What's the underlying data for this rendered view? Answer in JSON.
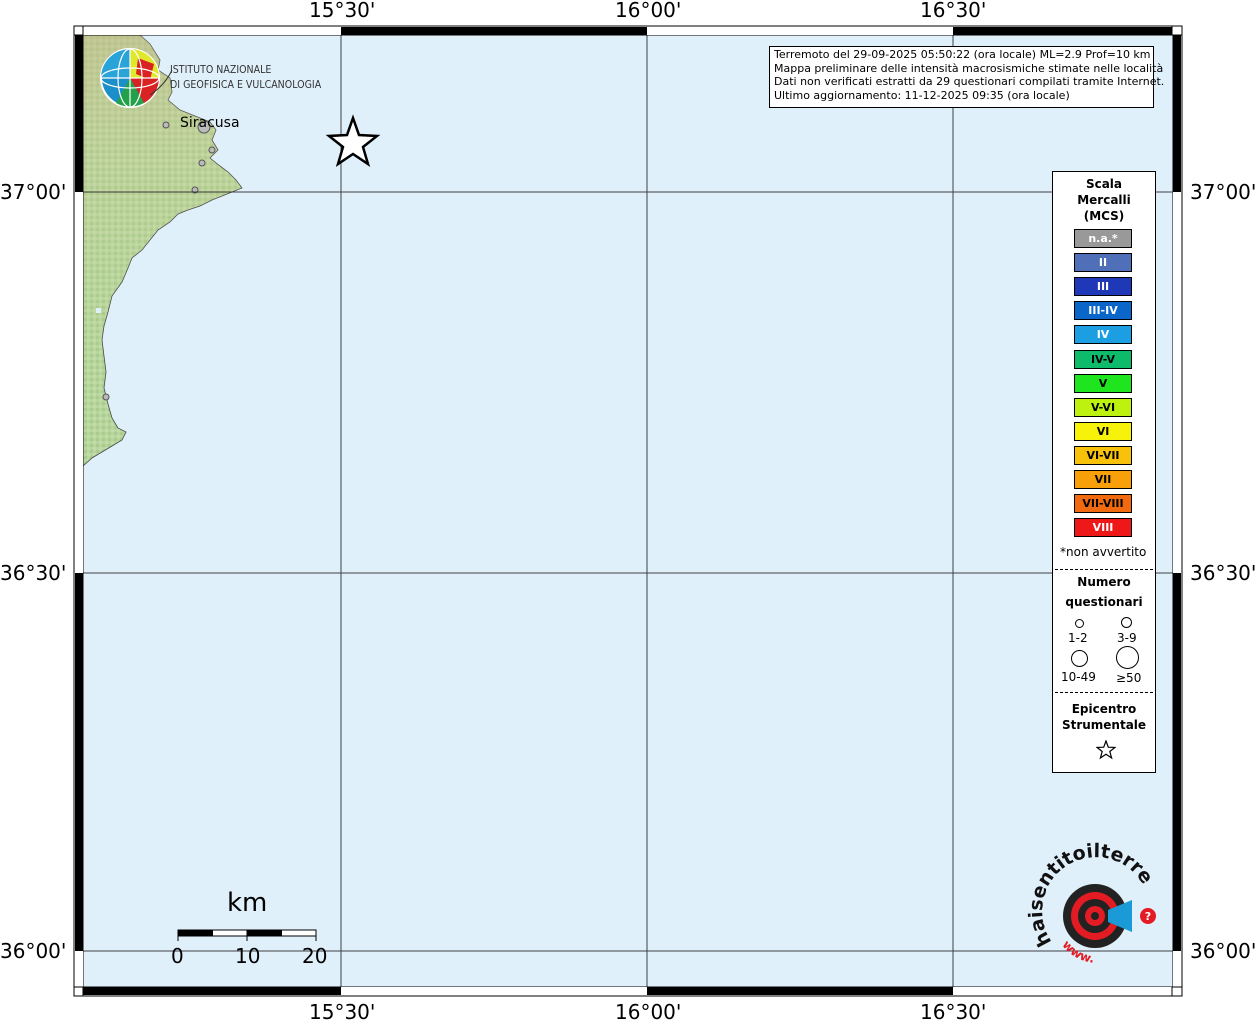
{
  "header": {
    "lines": [
      "Terremoto del 29-09-2025 05:50:22 (ora locale) ML=2.9 Prof=10 km",
      "Mappa preliminare delle intensità macrosismiche stimate nelle località",
      "Dati non verificati estratti da 29 questionari compilati tramite Internet.",
      "Ultimo aggiornamento: 11-12-2025 09:35 (ora locale)"
    ]
  },
  "axes": {
    "top": [
      "15°30'",
      "16°00'",
      "16°30'"
    ],
    "bottom": [
      "15°30'",
      "16°00'",
      "16°30'"
    ],
    "left": [
      "37°00'",
      "36°30'",
      "36°00'"
    ],
    "right": [
      "37°00'",
      "36°30'",
      "36°00'"
    ]
  },
  "map": {
    "place_label": "Siracusa",
    "logo": {
      "line1": "ISTITUTO NAZIONALE",
      "line2": "DI GEOFISICA E VULCANOLOGIA"
    },
    "scale_bar": {
      "unit": "km",
      "ticks": [
        "0",
        "10",
        "20"
      ]
    },
    "brand": {
      "main": "haisentitoilterremoto.it",
      "url": "www."
    },
    "colors": {
      "sea": "#e0f0fb",
      "land": "#b2d39a",
      "star": "#ffffff"
    }
  },
  "legend": {
    "scale_title": [
      "Scala",
      "Mercalli",
      "(MCS)"
    ],
    "intensities": [
      {
        "label": "n.a.*",
        "color": "#999999",
        "text_color": "#ffffff"
      },
      {
        "label": "II",
        "color": "#4f6fb8",
        "text_color": "#ffffff"
      },
      {
        "label": "III",
        "color": "#1f38b8",
        "text_color": "#ffffff"
      },
      {
        "label": "III-IV",
        "color": "#0a66c8",
        "text_color": "#ffffff"
      },
      {
        "label": "IV",
        "color": "#1c9ee2",
        "text_color": "#ffffff"
      },
      {
        "label": "IV-V",
        "color": "#0dbb6a",
        "text_color": "#000000"
      },
      {
        "label": "V",
        "color": "#1fe51f",
        "text_color": "#000000"
      },
      {
        "label": "V-VI",
        "color": "#bdf20e",
        "text_color": "#000000"
      },
      {
        "label": "VI",
        "color": "#f6f20a",
        "text_color": "#000000"
      },
      {
        "label": "VI-VII",
        "color": "#f8c10a",
        "text_color": "#000000"
      },
      {
        "label": "VII",
        "color": "#f8a00a",
        "text_color": "#000000"
      },
      {
        "label": "VII-VIII",
        "color": "#f26a10",
        "text_color": "#000000"
      },
      {
        "label": "VIII",
        "color": "#ee1818",
        "text_color": "#ffffff"
      }
    ],
    "not_felt": "*non avvertito",
    "count_title": [
      "Numero",
      "questionari"
    ],
    "counts": [
      "1-2",
      "3-9",
      "10-49",
      "≥50"
    ],
    "epicenter_title": [
      "Epicentro",
      "Strumentale"
    ]
  }
}
